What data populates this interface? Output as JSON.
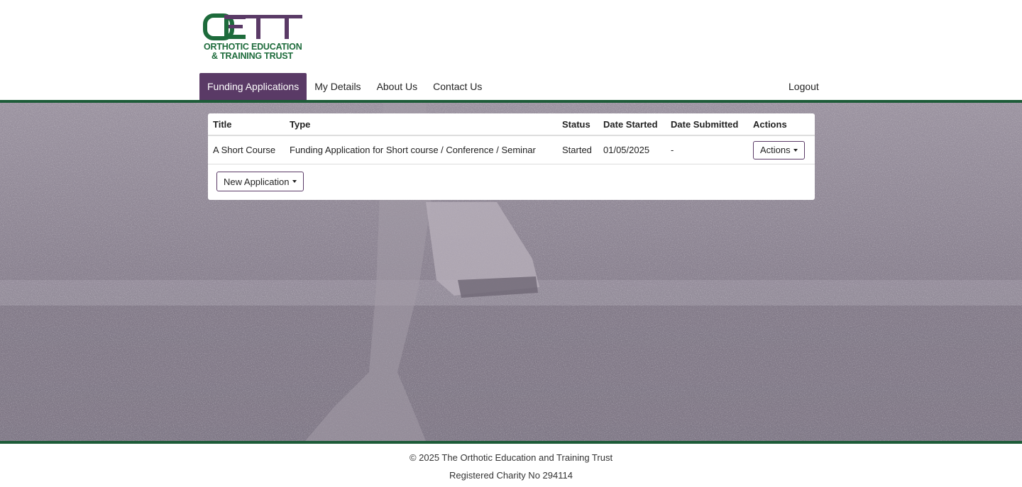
{
  "brand": {
    "logo_mark": "OETT",
    "logo_line1": "ORTHOTIC EDUCATION",
    "logo_line2": "& TRAINING TRUST",
    "green": "#1d6b3b",
    "purple": "#5a3a66"
  },
  "nav": {
    "items": [
      {
        "label": "Funding Applications",
        "active": true
      },
      {
        "label": "My Details",
        "active": false
      },
      {
        "label": "About Us",
        "active": false
      },
      {
        "label": "Contact Us",
        "active": false
      }
    ],
    "logout": "Logout"
  },
  "table": {
    "headers": [
      "Title",
      "Type",
      "Status",
      "Date Started",
      "Date Submitted",
      "Actions"
    ],
    "rows": [
      {
        "title": "A Short Course",
        "type": "Funding Application for Short course / Conference / Seminar",
        "status": "Started",
        "date_started": "01/05/2025",
        "date_submitted": "-",
        "actions_label": "Actions"
      }
    ]
  },
  "new_application_label": "New Application",
  "icons": {
    "dropdown": "caret-down-icon"
  },
  "footer": {
    "copyright": "© 2025 The Orthotic Education and Training Trust",
    "charity": "Registered Charity No 294114"
  }
}
